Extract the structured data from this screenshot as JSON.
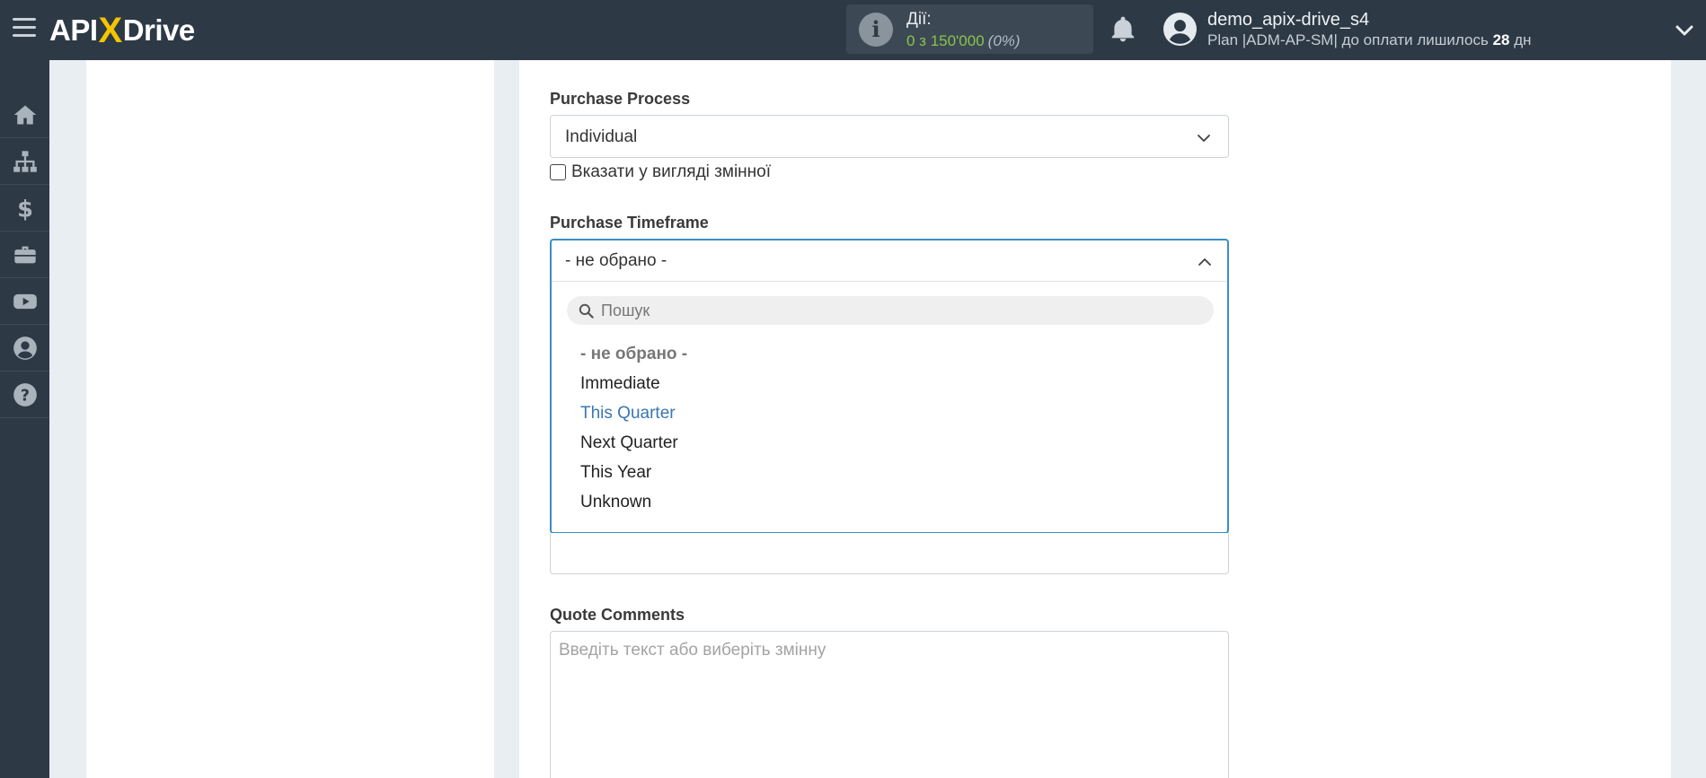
{
  "header": {
    "logo_left": "API",
    "logo_x": "X",
    "logo_right": "Drive",
    "actions_title": "Дії:",
    "actions_value": "0 з 150'000",
    "actions_percent": "(0%)",
    "user_name": "demo_apix-drive_s4",
    "plan_prefix": "Plan |ADM-AP-SM| до оплати лишилось",
    "plan_days": "28",
    "plan_suffix": "дн"
  },
  "sidebar": {
    "items": [
      {
        "icon": "home-icon"
      },
      {
        "icon": "sitemap-icon"
      },
      {
        "icon": "dollar-icon"
      },
      {
        "icon": "briefcase-icon"
      },
      {
        "icon": "youtube-icon"
      },
      {
        "icon": "user-circle-icon"
      },
      {
        "icon": "help-icon"
      }
    ]
  },
  "form": {
    "purchase_process": {
      "label": "Purchase Process",
      "value": "Individual",
      "checkbox_label": "Вказати у вигляді змінної",
      "checked": false
    },
    "purchase_timeframe": {
      "label": "Purchase Timeframe",
      "value": "- не обрано -",
      "search_placeholder": "Пошук",
      "options": [
        "- не обрано -",
        "Immediate",
        "This Quarter",
        "Next Quarter",
        "This Year",
        "Unknown"
      ],
      "highlighted": "This Quarter"
    },
    "quote_comments": {
      "label": "Quote Comments",
      "placeholder": "Введіть текст або виберіть змінну"
    }
  },
  "colors": {
    "topbar": "#2d3945",
    "accent_yellow": "#f5c400",
    "focus_border": "#3b8fc4",
    "highlight_option": "#3a77b2",
    "actions_value": "#8bc34a"
  }
}
